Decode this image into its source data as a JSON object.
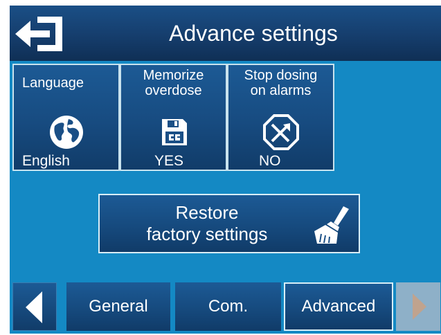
{
  "header": {
    "title": "Advance settings",
    "back_icon": "exit-arrow-icon"
  },
  "tiles": [
    {
      "title": "Language",
      "value": "English",
      "icon": "globe-icon"
    },
    {
      "title": "Memorize\noverdose",
      "value": "YES",
      "icon": "save-disk-icon"
    },
    {
      "title": "Stop dosing\non alarms",
      "value": "NO",
      "icon": "stop-octagon-icon"
    }
  ],
  "restore": {
    "label": "Restore\nfactory settings",
    "icon": "broom-icon"
  },
  "nav": {
    "tabs": [
      {
        "label": "General",
        "active": false
      },
      {
        "label": "Com.",
        "active": false
      },
      {
        "label": "Advanced",
        "active": true
      }
    ],
    "prev_icon": "arrow-left-icon",
    "next_icon": "arrow-right-icon",
    "next_enabled": false
  },
  "colors": {
    "background": "#1489c4",
    "header": "#163f6f",
    "tile": "#174b80",
    "border": "#c9e3ee",
    "text": "#ffffff",
    "disabled_arrow": "#c0a38e"
  }
}
